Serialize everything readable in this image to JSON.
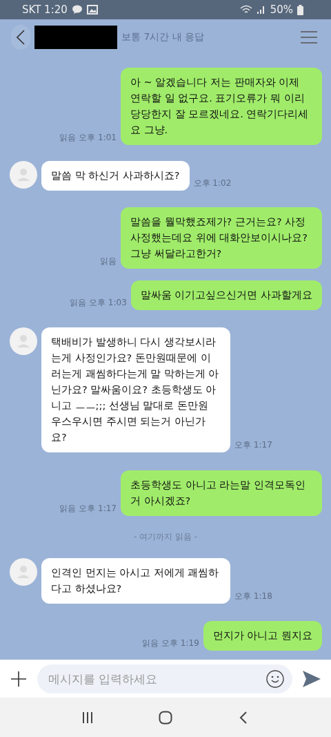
{
  "status_bar": {
    "carrier_time": "SKT 1:20",
    "battery": "50%"
  },
  "header": {
    "subtitle": "보통 7시간 내 응답"
  },
  "messages": [
    {
      "kind": "sent",
      "text": "아 ~ 알겠습니다 저는 판매자와 이제 연락할 일 없구요. 표기오류가 뭐 이리 당당한지 잘 모르겠네요. 연락기다리세요 그냥.",
      "meta": "읽음 오후 1:01"
    },
    {
      "kind": "received",
      "text": "말씀 막 하신거 사과하시죠?",
      "meta": "오후 1:02"
    },
    {
      "kind": "sent",
      "text": "말씀을 뭘막했죠제가? 근거는요? 사정 사정했는데요 위에 대화안보이시나요? 그냥 써달라고한거?",
      "meta": "읽음"
    },
    {
      "kind": "sent",
      "text": "말싸움 이기고싶으신거면 사과할게요",
      "meta": "읽음 오후 1:03"
    },
    {
      "kind": "received",
      "text": "택배비가 발생하니 다시 생각보시라는게 사정인가요? 돈만원때문에 이러는게 괘씸하다는게 말 막하는게 아닌가요? 말싸움이요? 초등학생도 아니고 ㅡㅡ;;; 선생님 말대로 돈만원 우스우시면 주시면 되는거 아닌가요?",
      "meta": "오후 1:17"
    },
    {
      "kind": "sent",
      "text": "초등학생도 아니고 라는말 인격모독인거 아시겠죠?",
      "meta": "읽음 오후 1:17"
    },
    {
      "kind": "divider",
      "text": "- 여기까지 읽음 -"
    },
    {
      "kind": "received",
      "text": "인격인 먼지는 아시고 저에게 괘씸하다고 하셨나요?",
      "meta": "오후 1:18"
    },
    {
      "kind": "sent",
      "text": "먼지가 아니고 뭔지요",
      "meta": "읽음 오후 1:19"
    }
  ],
  "composer": {
    "placeholder": "메시지를 입력하세요"
  }
}
